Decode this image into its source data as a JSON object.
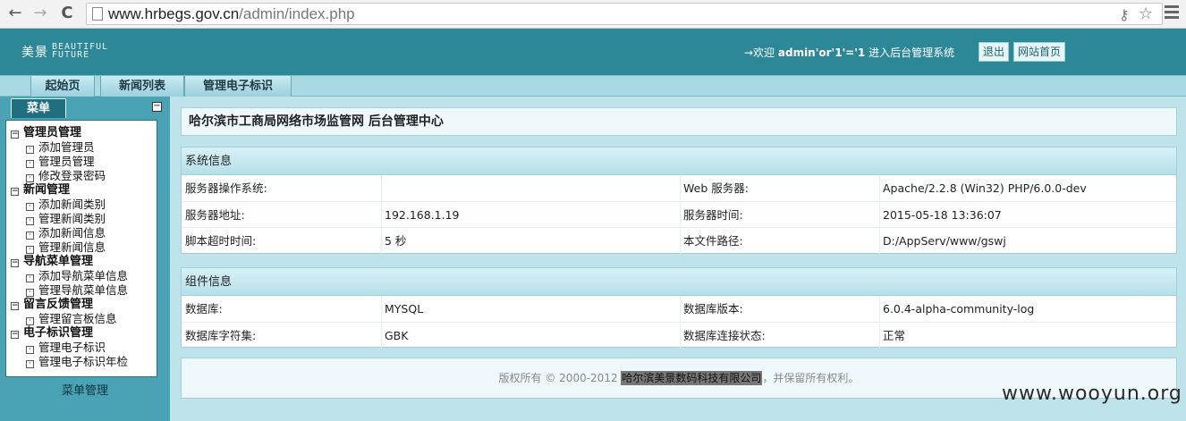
{
  "browser": {
    "back_icon": "←",
    "forward_icon": "→",
    "reload_icon": "C",
    "url_domain": "www.hrbegs.gov.cn",
    "url_path": "/admin/index.php",
    "key_icon": "⚷",
    "star_icon": "☆"
  },
  "header": {
    "logo_main": "美景",
    "logo_sub_1": "BEAUTIFUL",
    "logo_sub_2": "FUTURE",
    "welcome_prefix": "→欢迎 ",
    "welcome_user": "admin'or'1'='1",
    "welcome_suffix": " 进入后台管理系统",
    "logout_label": "退出",
    "home_label": "网站首页"
  },
  "tabs": [
    {
      "label": "起始页"
    },
    {
      "label": "新闻列表"
    },
    {
      "label": "管理电子标识"
    }
  ],
  "sidebar": {
    "tab_label": "菜单",
    "collapse_icon": "−",
    "footer": "菜单管理",
    "groups": [
      {
        "title": "管理员管理",
        "items": [
          "添加管理员",
          "管理员管理",
          "修改登录密码"
        ]
      },
      {
        "title": "新闻管理",
        "items": [
          "添加新闻类别",
          "管理新闻类别",
          "添加新闻信息",
          "管理新闻信息"
        ]
      },
      {
        "title": "导航菜单管理",
        "items": [
          "添加导航菜单信息",
          "管理导航菜单信息"
        ]
      },
      {
        "title": "留言反馈管理",
        "items": [
          "管理留言板信息"
        ]
      },
      {
        "title": "电子标识管理",
        "items": [
          "管理电子标识",
          "管理电子标识年检"
        ]
      }
    ]
  },
  "main": {
    "title": "哈尔滨市工商局网络市场监管网 后台管理中心",
    "system_info": {
      "heading": "系统信息",
      "rows": [
        {
          "k1": "服务器操作系统:",
          "v1": "",
          "k2": "Web 服务器:",
          "v2": "Apache/2.2.8 (Win32) PHP/6.0.0-dev"
        },
        {
          "k1": "服务器地址:",
          "v1": "192.168.1.19",
          "k2": "服务器时间:",
          "v2": "2015-05-18 13:36:07"
        },
        {
          "k1": "脚本超时时间:",
          "v1": "5 秒",
          "k2": "本文件路径:",
          "v2": "D:/AppServ/www/gswj"
        }
      ]
    },
    "component_info": {
      "heading": "组件信息",
      "rows": [
        {
          "k1": "数据库:",
          "v1": "MYSQL",
          "k2": "数据库版本:",
          "v2": "6.0.4-alpha-community-log"
        },
        {
          "k1": "数据库字符集:",
          "v1": "GBK",
          "k2": "数据库连接状态:",
          "v2": "正常"
        }
      ]
    },
    "footer_prefix": "版权所有 © 2000-2012 ",
    "footer_company": "哈尔滨美景数码科技有限公司",
    "footer_suffix": "，并保留所有权利。"
  },
  "watermark": "www.wooyun.org"
}
